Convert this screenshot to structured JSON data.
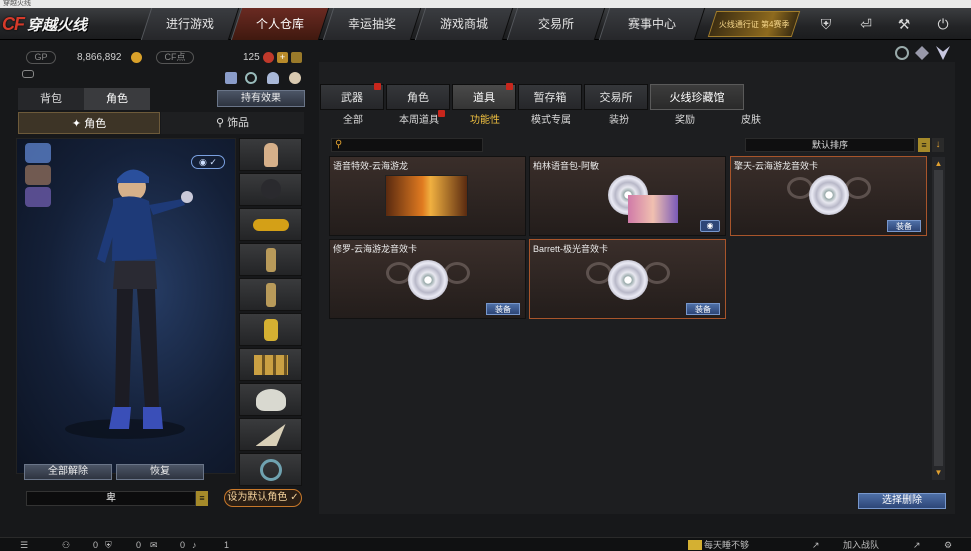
{
  "window": {
    "title": "穿越火线"
  },
  "nav": {
    "logo_text": "穿越火线",
    "tabs": [
      "进行游戏",
      "个人仓库",
      "幸运抽奖",
      "游戏商城",
      "交易所",
      "赛事中心"
    ],
    "active_tab": "个人仓库",
    "promo": "火线通行证 第4赛季"
  },
  "resources": {
    "gp_label": "GP",
    "gp_value": "8,866,892",
    "cf_label": "CF点",
    "cf_value": "",
    "count": "125"
  },
  "left": {
    "tabs": [
      "背包",
      "角色"
    ],
    "active_tab": "角色",
    "effect_button": "持有效果",
    "subtabs": [
      "角色",
      "饰品"
    ],
    "clear_all_button": "全部解除",
    "restore_button": "恢复",
    "name_field_value": "卑",
    "set_default_button": "设为默认角色"
  },
  "right": {
    "categories": [
      "武器",
      "角色",
      "道具",
      "暂存箱",
      "交易所",
      "火线珍藏馆"
    ],
    "active_category": "道具",
    "filters": [
      "全部",
      "本周道具",
      "功能性",
      "模式专属",
      "装扮",
      "奖励",
      "皮肤"
    ],
    "active_filter": "功能性",
    "sort_label": "默认排序",
    "search_placeholder": "",
    "items": [
      {
        "title": "语音特效-云海游龙",
        "type": "dragon",
        "button": ""
      },
      {
        "title": "柏林语音包-阿敏",
        "type": "voice",
        "button": ""
      },
      {
        "title": "擎天-云海游龙音效卡",
        "type": "disc",
        "button": "装备"
      },
      {
        "title": "修罗-云海游龙音效卡",
        "type": "disc",
        "button": "装备"
      },
      {
        "title": "Barrett-极光音效卡",
        "type": "disc",
        "button": "装备"
      }
    ],
    "batch_delete_button": "选择删除"
  },
  "bottom": {
    "c1": "0",
    "c2": "0",
    "c3": "0",
    "c4": "1",
    "daily": "每天睡不够",
    "join": "加入战队"
  },
  "colors": {
    "accent": "#a8552b",
    "highlight": "#f0c040",
    "button_blue": "#2d4677"
  }
}
